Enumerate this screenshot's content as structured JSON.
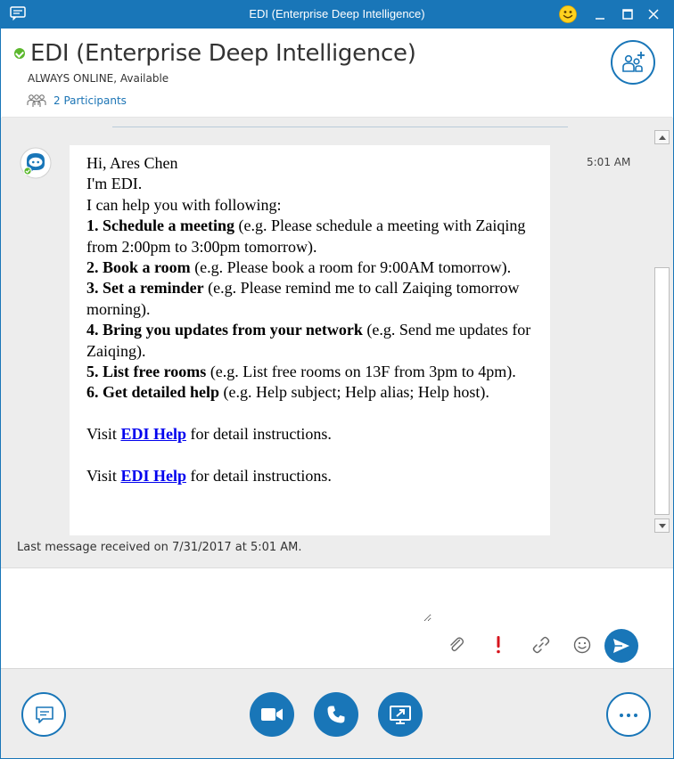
{
  "window": {
    "title": "EDI (Enterprise Deep Intelligence)"
  },
  "header": {
    "conversation_title": "EDI (Enterprise Deep Intelligence)",
    "status": "ALWAYS ONLINE, Available",
    "participants_label": "2 Participants"
  },
  "message": {
    "time": "5:01 AM",
    "greeting": "Hi, Ares Chen",
    "intro": "I'm EDI.",
    "lead": "I can help you with following:",
    "items": [
      {
        "title": "1. Schedule a meeting",
        "example": " (e.g. Please schedule a meeting with Zaiqing from 2:00pm to 3:00pm tomorrow)."
      },
      {
        "title": "2. Book a room",
        "example": " (e.g. Please book a room for 9:00AM tomorrow)."
      },
      {
        "title": "3. Set a reminder",
        "example": " (e.g. Please remind me to call Zaiqing tomorrow morning)."
      },
      {
        "title": "4. Bring you updates from your network",
        "example": " (e.g. Send me updates for Zaiqing)."
      },
      {
        "title": "5. List free rooms",
        "example": " (e.g. List free rooms on 13F from 3pm to 4pm)."
      },
      {
        "title": "6. Get detailed help",
        "example": " (e.g. Help subject; Help alias; Help host)."
      }
    ],
    "visit_prefix": "Visit ",
    "help_link": "EDI Help",
    "visit_suffix": " for detail instructions."
  },
  "footer_status": {
    "last_message": "Last message received on 7/31/2017 at 5:01 AM."
  },
  "compose": {
    "placeholder": ""
  },
  "icons": {
    "app": "chat-bubble-icon",
    "emoji": "smiley-icon",
    "add_people": "add-people-icon",
    "participants": "people-group-icon",
    "attach": "paperclip-icon",
    "importance": "exclamation-icon",
    "link": "link-icon",
    "emoticon": "emoticon-icon",
    "send": "send-icon",
    "im": "im-icon",
    "video": "video-camera-icon",
    "call": "phone-icon",
    "present": "present-screen-icon",
    "more": "more-options-icon"
  },
  "colors": {
    "accent": "#1976b8",
    "online": "#5cb82e",
    "importance": "#d6151e",
    "link": "#0000ee"
  }
}
